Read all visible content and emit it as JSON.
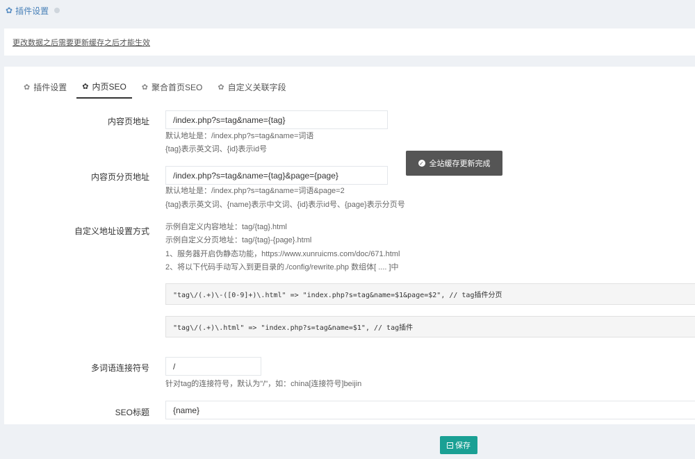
{
  "header": {
    "title": "插件设置"
  },
  "notice": {
    "text": "更改数据之后需要更新缓存之后才能生效"
  },
  "tabs": [
    {
      "label": "插件设置",
      "icon": "gear-icon"
    },
    {
      "label": "内页SEO",
      "icon": "gear-icon",
      "active": true
    },
    {
      "label": "聚合首页SEO",
      "icon": "gear-icon"
    },
    {
      "label": "自定义关联字段",
      "icon": "gear-icon"
    }
  ],
  "form": {
    "content_url": {
      "label": "内容页地址",
      "value": "/index.php?s=tag&name={tag}",
      "help1": "默认地址是：/index.php?s=tag&name=词语",
      "help2": "{tag}表示英文词、{id}表示id号"
    },
    "page_url": {
      "label": "内容页分页地址",
      "value": "/index.php?s=tag&name={tag}&page={page}",
      "help1": "默认地址是：/index.php?s=tag&name=词语&page=2",
      "help2": "{tag}表示英文词、{name}表示中文词、{id}表示id号、{page}表示分页号"
    },
    "custom": {
      "label": "自定义地址设置方式",
      "line1": "示例自定义内容地址：tag/{tag}.html",
      "line2": "示例自定义分页地址：tag/{tag}-{page}.html",
      "line3": "1、服务器开启伪静态功能，https://www.xunruicms.com/doc/671.html",
      "line4": "2、将以下代码手动写入到更目录的./config/rewrite.php 数组体[ .... ]中",
      "code1": "\"tag\\/(.+)\\-([0-9]+)\\.html\" => \"index.php?s=tag&name=$1&page=$2\",  // tag插件分页",
      "code2": "\"tag\\/(.+)\\.html\" => \"index.php?s=tag&name=$1\",  // tag插件"
    },
    "separator": {
      "label": "多词语连接符号",
      "value": "/",
      "help": "针对tag的连接符号，默认为\"/\"，如：china[连接符号]beijin"
    },
    "seo_title": {
      "label": "SEO标题",
      "value": "{name}"
    }
  },
  "toast": {
    "text": "全站缓存更新完成"
  },
  "footer": {
    "save_label": "保存"
  },
  "colors": {
    "accent": "#1aa094",
    "link": "#4a82b9",
    "toast_bg": "#555555"
  }
}
